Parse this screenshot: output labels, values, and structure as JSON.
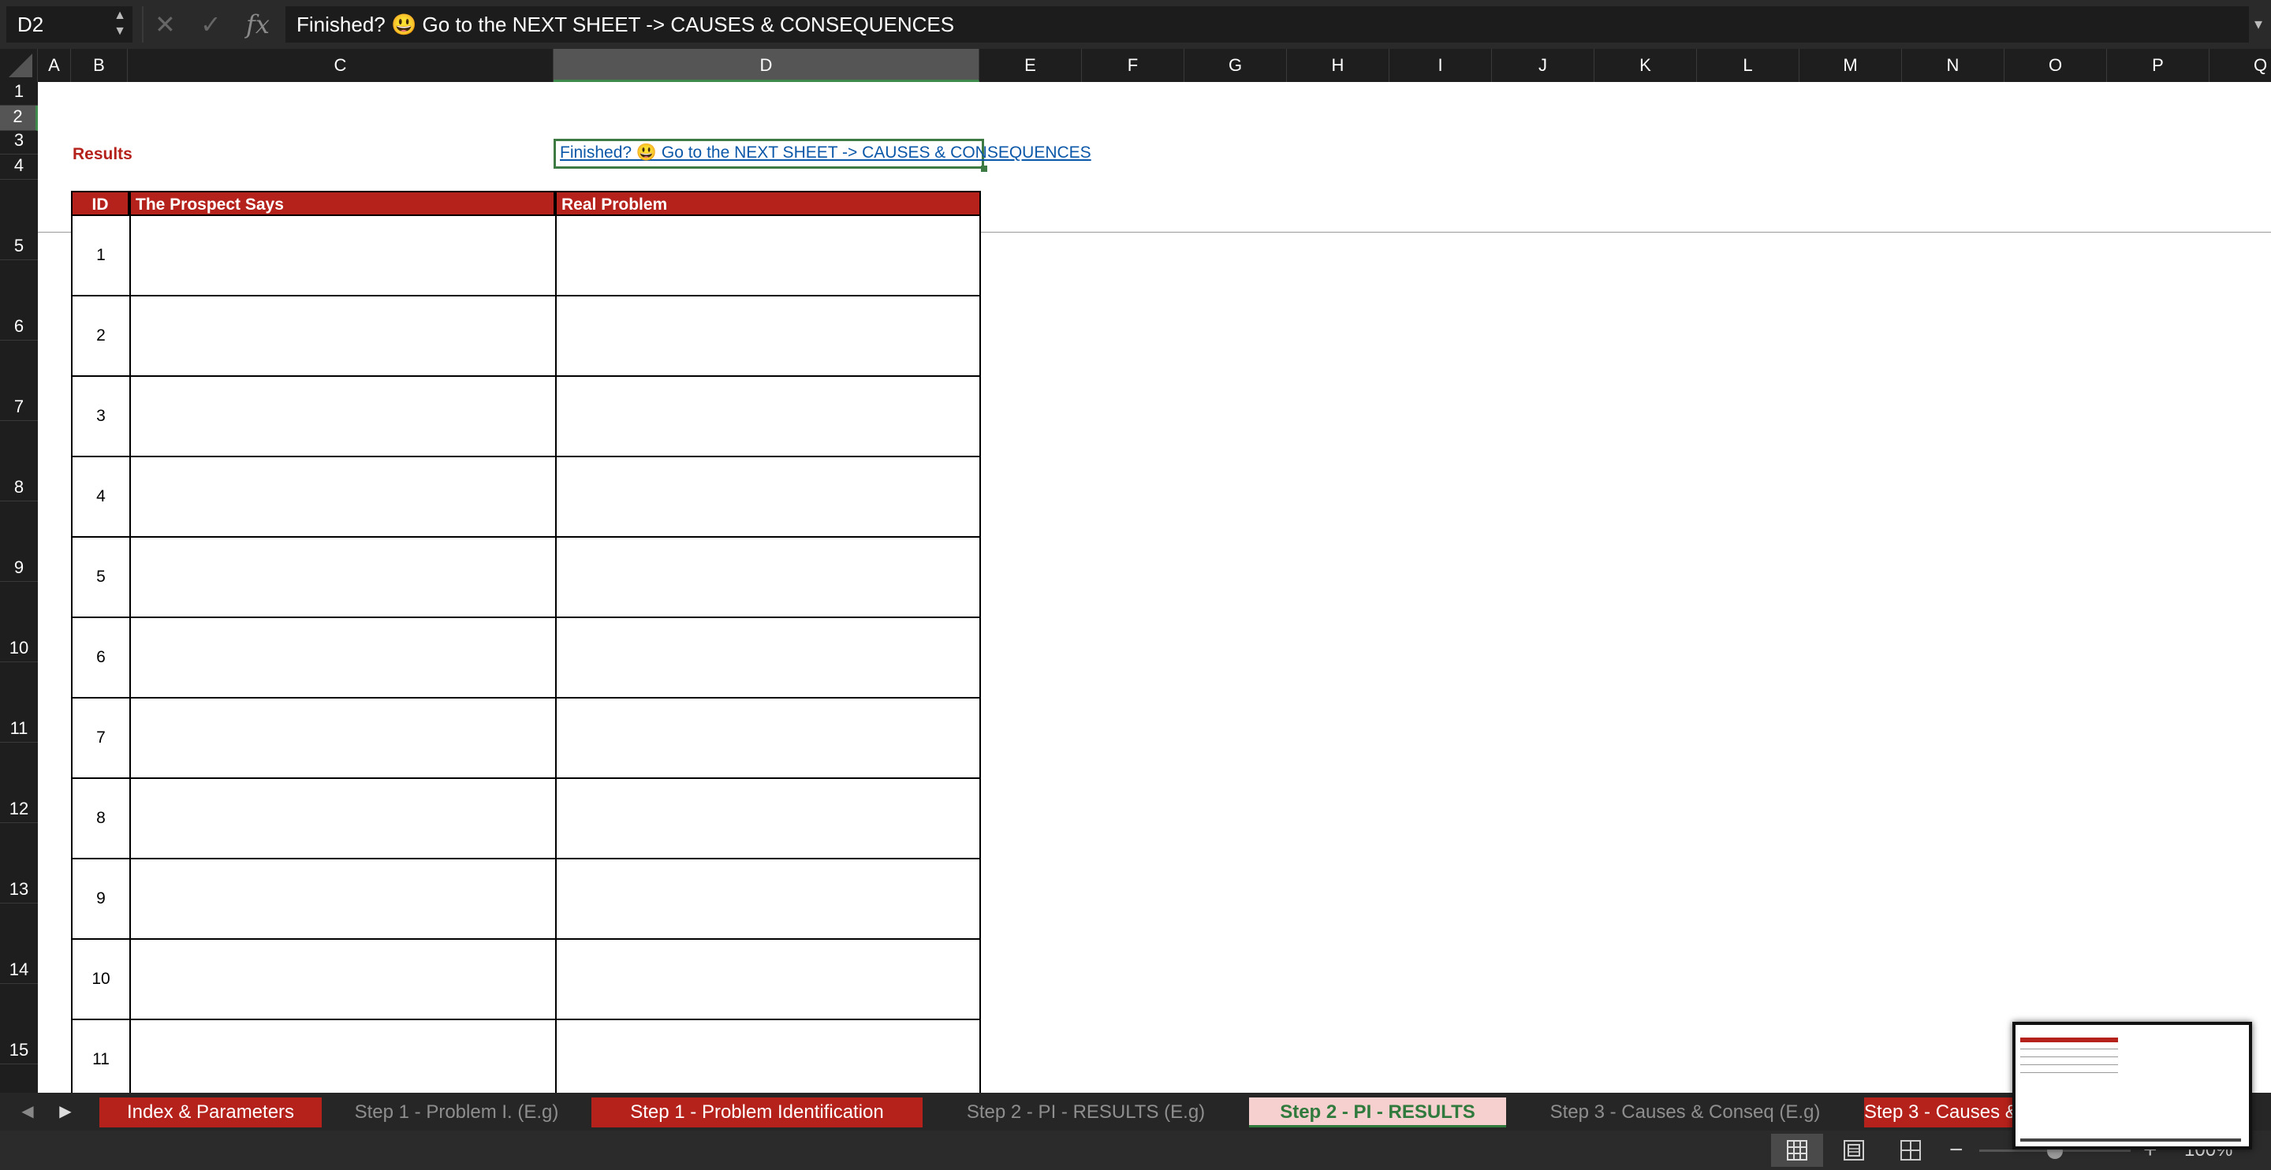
{
  "formula_bar": {
    "name_box": "D2",
    "cancel_glyph": "✕",
    "confirm_glyph": "✓",
    "fx_label": "fx",
    "formula": "Finished? 😃 Go to the NEXT SHEET -> CAUSES & CONSEQUENCES"
  },
  "columns": [
    "A",
    "B",
    "C",
    "D",
    "E",
    "F",
    "G",
    "H",
    "I",
    "J",
    "K",
    "L",
    "M",
    "N",
    "O",
    "P",
    "Q"
  ],
  "selected_column": "D",
  "rows": [
    "1",
    "2",
    "3",
    "4",
    "5",
    "6",
    "7",
    "8",
    "9",
    "10",
    "11",
    "12",
    "13",
    "14",
    "15"
  ],
  "selected_row": "2",
  "sheet": {
    "results_label": "Results",
    "link_text": "Finished? 😃 Go to the NEXT SHEET -> CAUSES & CONSEQUENCES ",
    "table": {
      "headers": [
        "ID",
        "The Prospect Says",
        "Real Problem"
      ],
      "ids": [
        "1",
        "2",
        "3",
        "4",
        "5",
        "6",
        "7",
        "8",
        "9",
        "10",
        "11"
      ]
    }
  },
  "tabs": [
    {
      "label": "Index & Parameters",
      "style": "red"
    },
    {
      "label": "Step 1 - Problem I. (E.g)",
      "style": "plain"
    },
    {
      "label": "Step 1 - Problem Identification",
      "style": "red"
    },
    {
      "label": "Step 2 - PI - RESULTS (E.g)",
      "style": "plain"
    },
    {
      "label": "Step 2 - PI - RESULTS",
      "style": "active"
    },
    {
      "label": "Step 3 - Causes & Conseq (E.g)",
      "style": "plain"
    },
    {
      "label": "Step 3 - Causes & Consequences",
      "style": "red"
    }
  ],
  "status": {
    "zoom": "100%",
    "zoom_fraction": 0.5
  },
  "colors": {
    "accent_red": "#b5211b",
    "selection_green": "#3e7a44",
    "link_blue": "#0b57a8"
  }
}
